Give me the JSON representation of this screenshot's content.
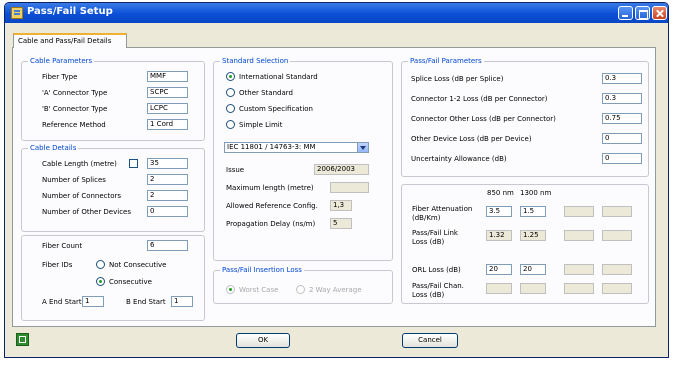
{
  "window": {
    "title": "Pass/Fail Setup"
  },
  "tab": {
    "label": "Cable and Pass/Fail Details"
  },
  "cable_parameters": {
    "title": "Cable Parameters",
    "fiber_type": {
      "label": "Fiber Type",
      "value": "MMF"
    },
    "a_connector": {
      "label": "'A' Connector Type",
      "value": "SCPC"
    },
    "b_connector": {
      "label": "'B' Connector Type",
      "value": "LCPC"
    },
    "reference_method": {
      "label": "Reference Method",
      "value": "1 Cord"
    }
  },
  "cable_details": {
    "title": "Cable Details",
    "cable_length": {
      "label": "Cable Length (metre)",
      "value": "35"
    },
    "num_splices": {
      "label": "Number of Splices",
      "value": "2"
    },
    "num_connectors": {
      "label": "Number of Connectors",
      "value": "2"
    },
    "num_other_devices": {
      "label": "Number of Other Devices",
      "value": "0"
    }
  },
  "fiber": {
    "count_label": "Fiber Count",
    "count_value": "6",
    "ids_label": "Fiber IDs",
    "non_consecutive": "Not Consecutive",
    "consecutive": "Consecutive",
    "a_end_start_label": "A End Start",
    "a_end_start_value": "1",
    "b_end_start_label": "B End Start",
    "b_end_start_value": "1"
  },
  "standard_selection": {
    "title": "Standard Selection",
    "options": [
      "International Standard",
      "Other Standard",
      "Custom Specification",
      "Simple Limit"
    ],
    "selected": 0,
    "dropdown_value": "IEC 11801 / 14763-3:  MM",
    "issue_label": "Issue",
    "issue_value": "2006/2003",
    "max_length_label": "Maximum length (metre)",
    "max_length_value": "",
    "allowed_ref_label": "Allowed Reference Config.",
    "allowed_ref_value": "1,3",
    "prop_delay_label": "Propagation Delay (ns/m)",
    "prop_delay_value": "5"
  },
  "insertion_loss": {
    "title": "Pass/Fail Insertion Loss",
    "worst_case": "Worst Case",
    "two_way": "2 Way Average"
  },
  "pf_parameters": {
    "title": "Pass/Fail Parameters",
    "splice_loss": {
      "label": "Splice Loss (dB per Splice)",
      "value": "0.3"
    },
    "connector_loss": {
      "label": "Connector 1-2 Loss (dB per Connector)",
      "value": "0.3"
    },
    "connector_other": {
      "label": "Connector Other Loss (dB per Connector)",
      "value": "0.75"
    },
    "other_device": {
      "label": "Other Device Loss (dB per Device)",
      "value": "0"
    },
    "uncertainty": {
      "label": "Uncertainty Allowance (dB)",
      "value": "0"
    }
  },
  "wavelengths": {
    "col1": "850 nm",
    "col2": "1300 nm",
    "fiber_atten": {
      "label1": "Fiber Attenuation",
      "label2": "(dB/Km)",
      "v1": "3.5",
      "v2": "1.5"
    },
    "link_loss": {
      "label1": "Pass/Fail Link",
      "label2": "Loss (dB)",
      "v1": "1.32",
      "v2": "1.25"
    },
    "orl_loss": {
      "label": "ORL Loss (dB)",
      "v1": "20",
      "v2": "20"
    },
    "chan_loss": {
      "label1": "Pass/Fail Chan.",
      "label2": "Loss (dB)"
    }
  },
  "buttons": {
    "ok": "OK",
    "cancel": "Cancel"
  },
  "icons": {
    "export": "export-icon"
  },
  "colors": {
    "titlebar": "#0b4fd6",
    "group_title": "#0046d5",
    "radio_dot": "#21a121"
  }
}
